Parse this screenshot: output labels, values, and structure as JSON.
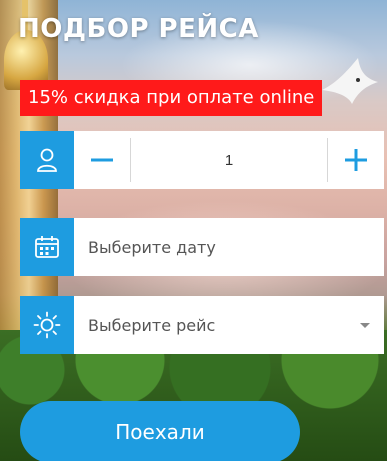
{
  "header": {
    "title": "ПОДБОР РЕЙСА"
  },
  "promo": {
    "text": "15% скидка при оплате online"
  },
  "passengers": {
    "value": "1",
    "minus_icon": "minus-icon",
    "plus_icon": "plus-icon",
    "icon": "person-icon"
  },
  "date": {
    "placeholder": "Выберите дату",
    "icon": "calendar-icon"
  },
  "flight": {
    "placeholder": "Выберите рейс",
    "icon": "sun-icon"
  },
  "submit": {
    "label": "Поехали"
  },
  "colors": {
    "accent": "#1e9ce0",
    "promo_bg": "#ff1a1a"
  }
}
